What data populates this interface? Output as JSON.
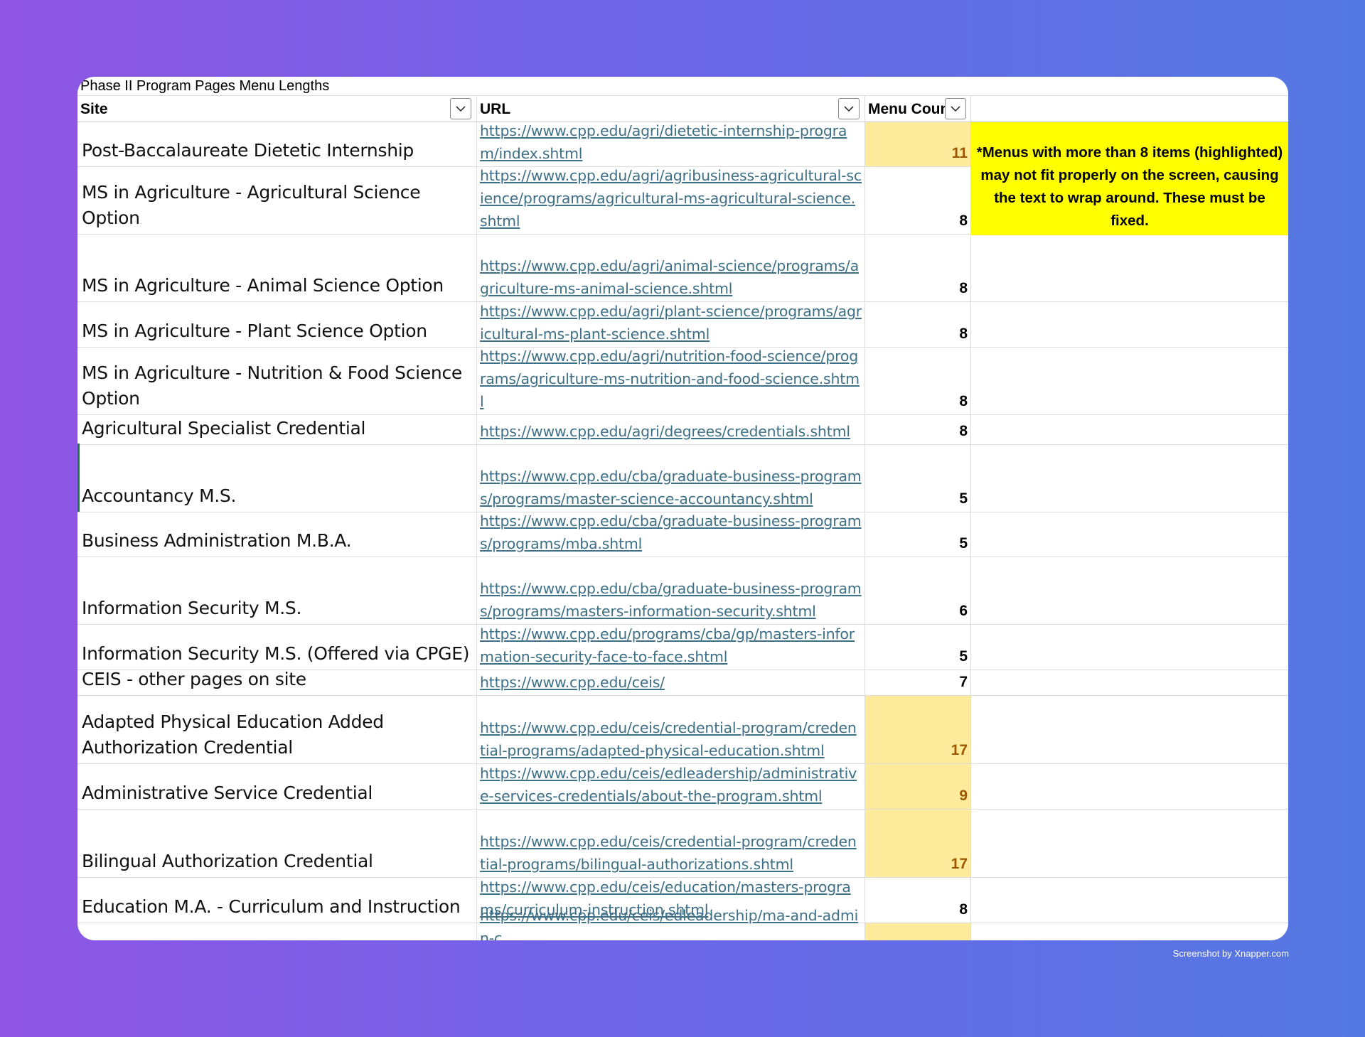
{
  "sheet": {
    "title": "Phase II Program Pages Menu Lengths",
    "headers": {
      "site": "Site",
      "url": "URL",
      "count": "Menu Coun"
    },
    "note": "*Menus with more than 8 items (highlighted) may not fit properly on the screen, causing the text to wrap around. These must be fixed.",
    "highlight_color": "#ffeb9c",
    "note_color": "#ffff00",
    "link_color": "#3d6f86",
    "rows": [
      {
        "site": "Post-Baccalaureate Dietetic Internship",
        "url": "https://www.cpp.edu/agri/dietetic-internship-program/index.shtml",
        "count": "11",
        "highlight": true
      },
      {
        "site": "MS in Agriculture - Agricultural Science Option",
        "url": "https://www.cpp.edu/agri/agribusiness-agricultural-science/programs/agricultural-ms-agricultural-science.shtml",
        "count": "8",
        "highlight": false
      },
      {
        "site": "MS in Agriculture - Animal Science Option",
        "url": "https://www.cpp.edu/agri/animal-science/programs/agriculture-ms-animal-science.shtml",
        "count": "8",
        "highlight": false
      },
      {
        "site": "MS in Agriculture - Plant Science Option",
        "url": "https://www.cpp.edu/agri/plant-science/programs/agricultural-ms-plant-science.shtml",
        "count": "8",
        "highlight": false
      },
      {
        "site": "MS in Agriculture - Nutrition & Food Science Option",
        "url": "https://www.cpp.edu/agri/nutrition-food-science/programs/agriculture-ms-nutrition-and-food-science.shtml",
        "count": "8",
        "highlight": false
      },
      {
        "site": "Agricultural Specialist Credential",
        "url": "https://www.cpp.edu/agri/degrees/credentials.shtml",
        "count": "8",
        "highlight": false
      },
      {
        "site": "Accountancy M.S.",
        "url": "https://www.cpp.edu/cba/graduate-business-programs/programs/master-science-accountancy.shtml",
        "count": "5",
        "highlight": false
      },
      {
        "site": "Business Administration M.B.A.",
        "url": "https://www.cpp.edu/cba/graduate-business-programs/programs/mba.shtml",
        "count": "5",
        "highlight": false
      },
      {
        "site": "Information Security M.S.",
        "url": "https://www.cpp.edu/cba/graduate-business-programs/programs/masters-information-security.shtml",
        "count": "6",
        "highlight": false
      },
      {
        "site": "Information Security M.S. (Offered via CPGE)",
        "url": "https://www.cpp.edu/programs/cba/gp/masters-information-security-face-to-face.shtml",
        "count": "5",
        "highlight": false
      },
      {
        "site": "CEIS - other pages on site",
        "url": "https://www.cpp.edu/ceis/",
        "count": "7",
        "highlight": false
      },
      {
        "site": "Adapted Physical Education Added Authorization Credential",
        "url": "https://www.cpp.edu/ceis/credential-program/credential-programs/adapted-physical-education.shtml",
        "count": "17",
        "highlight": true
      },
      {
        "site": "Administrative Service Credential",
        "url": "https://www.cpp.edu/ceis/edleadership/administrative-services-credentials/about-the-program.shtml",
        "count": "9",
        "highlight": true
      },
      {
        "site": "Bilingual Authorization Credential",
        "url": "https://www.cpp.edu/ceis/credential-program/credential-programs/bilingual-authorizations.shtml",
        "count": "17",
        "highlight": true
      },
      {
        "site": "Education M.A. - Curriculum and Instruction",
        "url": "https://www.cpp.edu/ceis/education/masters-programs/curriculum-instruction.shtml",
        "count": "8",
        "highlight": false
      },
      {
        "site": "",
        "url": "https://www.cpp.edu/ceis/edleadership/ma-and-admin-c",
        "count": "",
        "highlight": true
      }
    ]
  },
  "credit": "Screenshot by Xnapper.com"
}
